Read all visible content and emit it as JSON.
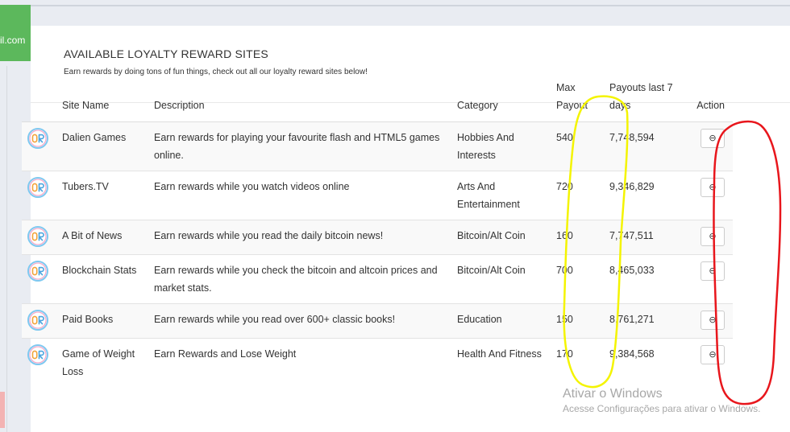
{
  "left_tab": {
    "text": "il.com"
  },
  "card": {
    "title": "AVAILABLE LOYALTY REWARD SITES",
    "subtitle": "Earn rewards by doing tons of fun things, check out all our loyalty reward sites below!"
  },
  "table": {
    "headers": {
      "site_name": "Site Name",
      "description": "Description",
      "category": "Category",
      "max_payout": "Max Payout",
      "payouts_last_7": "Payouts last 7 days",
      "action": "Action"
    },
    "rows": [
      {
        "name": "Dalien Games",
        "description": "Earn rewards for playing your favourite flash and HTML5 games online.",
        "category": "Hobbies And Interests",
        "max_payout": "540",
        "payouts": "7,748,594"
      },
      {
        "name": "Tubers.TV",
        "description": "Earn rewards while you watch videos online",
        "category": "Arts And Entertainment",
        "max_payout": "720",
        "payouts": "9,346,829"
      },
      {
        "name": "A Bit of News",
        "description": "Earn rewards while you read the daily bitcoin news!",
        "category": "Bitcoin/Alt Coin",
        "max_payout": "160",
        "payouts": "7,747,511"
      },
      {
        "name": "Blockchain Stats",
        "description": "Earn rewards while you check the bitcoin and altcoin prices and market stats.",
        "category": "Bitcoin/Alt Coin",
        "max_payout": "700",
        "payouts": "8,465,033"
      },
      {
        "name": "Paid Books",
        "description": "Earn rewards while you read over 600+ classic books!",
        "category": "Education",
        "max_payout": "150",
        "payouts": "8,761,271"
      },
      {
        "name": "Game of Weight Loss",
        "description": "Earn Rewards and Lose Weight",
        "category": "Health And Fitness",
        "max_payout": "170",
        "payouts": "9,384,568"
      }
    ],
    "action_icon": "link-icon"
  },
  "watermark": {
    "title": "Ativar o Windows",
    "subtitle": "Acesse Configurações para ativar o Windows."
  },
  "colors": {
    "annotation_yellow": "#f4f400",
    "annotation_red": "#e8161c",
    "green_tab": "#5cb85c"
  }
}
